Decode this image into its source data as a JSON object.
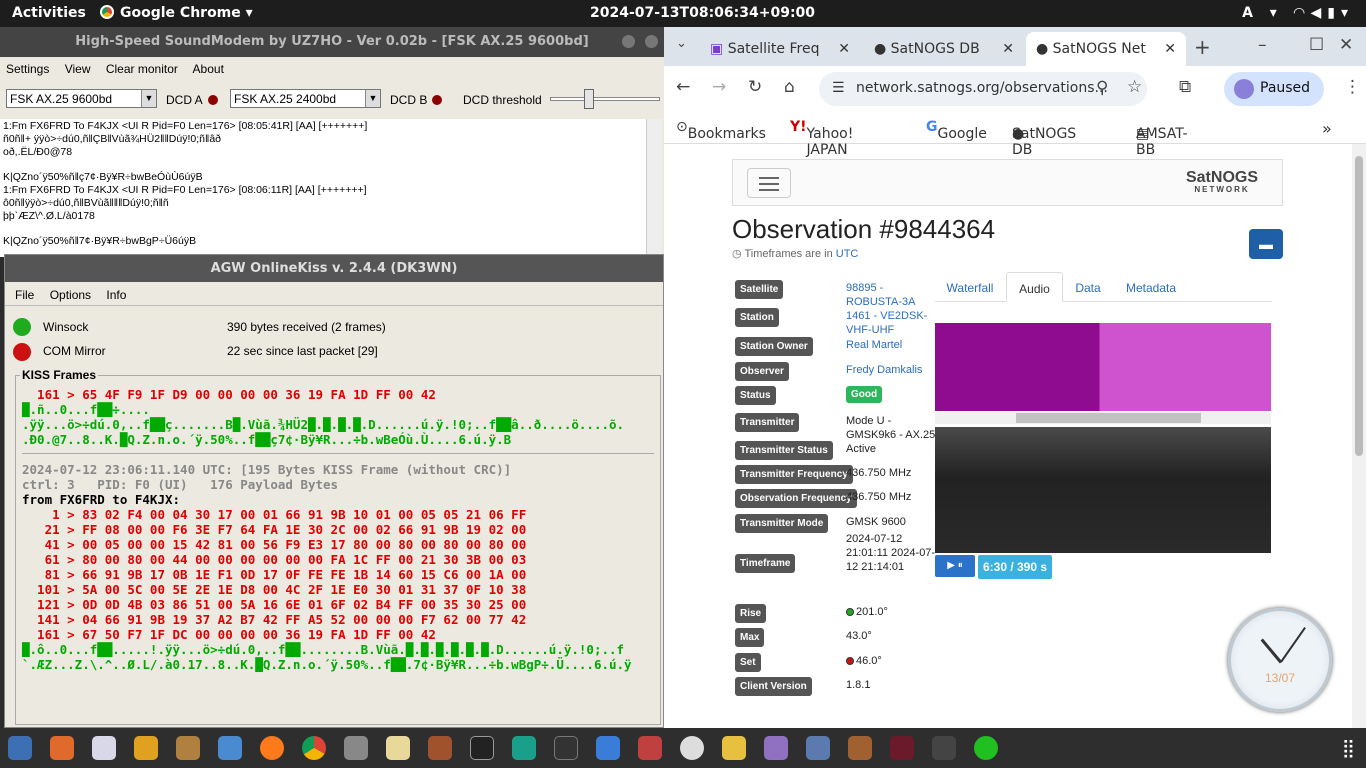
{
  "topbar": {
    "activities": "Activities",
    "app": "Google Chrome ▾",
    "clock": "2024-07-13T08:06:34+09:00",
    "tray": "A ▾"
  },
  "soundmodem": {
    "title": "High-Speed SoundModem by UZ7HO - Ver 0.02b - [FSK AX.25 9600bd]",
    "menu": [
      "Settings",
      "View",
      "Clear monitor",
      "About"
    ],
    "modem_a": "FSK AX.25 9600bd",
    "dcd_a": "DCD A",
    "modem_b": "FSK AX.25 2400bd",
    "dcd_b": "DCD B",
    "threshold": "DCD threshold",
    "monitor": [
      "1:Fm FX6FRD To F4KJX <UI R Pid=F0 Len=176> [08:05:41R] [AA] [+++++++]",
      "ñ0ñ‖+ ÿÿò>÷dú0,ñ‖ÇB‖Vùã¾HÜ2‖‖Dúÿ!0;ñ‖âð",
      "oð,.ËL/Ð0@78",
      "",
      "K|QZno´ÿ50%ñ‖ç7¢·Bÿ¥R÷bwBeÓùÙ6úÿB",
      "1:Fm FX6FRD To F4KJX <UI R Pid=F0 Len=176> [08:06:11R] [AA] [+++++++]",
      "ô0ñ‖ÿÿò>÷dú0,ñ‖BVùã‖‖‖Dúÿ!0;ñ‖ñ",
      "þþ`ÆZ\\^.Ø.L/à0178",
      "",
      "K|QZno´ÿ50%ñ‖7¢·Bÿ¥R÷bwBgP÷Ü6úÿB"
    ]
  },
  "agw": {
    "title": "AGW OnlineKiss v. 2.4.4  (DK3WN)",
    "menu": [
      "File",
      "Options",
      "Info"
    ],
    "status": [
      {
        "name": "Winsock",
        "info": "390 bytes received (2 frames)",
        "color": "#1faa1f"
      },
      {
        "name": "COM Mirror",
        "info": "22 sec since last packet [29]",
        "color": "#cc1111"
      }
    ],
    "frames_label": "KISS Frames",
    "lines_top": [
      {
        "c": "red",
        "t": "  161 > 65 4F F9 1F D9 00 00 00 00 36 19 FA 1D FF 00 42"
      },
      {
        "c": "grn",
        "t": "█.ñ..0...f██÷...."
      },
      {
        "c": "grn",
        "t": ".ÿÿ...ö>÷dú.0,..f██ç.......B█.Vùã.¾HÜ2█.█.█.█.D......ú.ÿ.!0;..f██â..ð....ö....õ."
      },
      {
        "c": "grn",
        "t": ".Ð0.@7..8..K.█Q.Z.n.o.´ÿ.50%..f██ç7¢·Bÿ¥R...÷b.wBeÓù.Ù....6.ú.ÿ.B"
      }
    ],
    "lines_bottom": [
      {
        "c": "gry",
        "t": "2024-07-12 23:06:11.140 UTC: [195 Bytes KISS Frame (without CRC)]"
      },
      {
        "c": "gry",
        "t": "ctrl: 3   PID: F0 (UI)   176 Payload Bytes"
      },
      {
        "c": "blk",
        "t": "from FX6FRD to F4KJX:"
      },
      {
        "c": "red",
        "t": "    1 > 83 02 F4 00 04 30 17 00 01 66 91 9B 10 01 00 05 05 21 06 FF"
      },
      {
        "c": "red",
        "t": "   21 > FF 08 00 00 F6 3E F7 64 FA 1E 30 2C 00 02 66 91 9B 19 02 00"
      },
      {
        "c": "red",
        "t": "   41 > 00 05 00 00 15 42 81 00 56 F9 E3 17 80 00 80 00 80 00 80 00"
      },
      {
        "c": "red",
        "t": "   61 > 80 00 80 00 44 00 00 00 00 00 00 FA 1C FF 00 21 30 3B 00 03"
      },
      {
        "c": "red",
        "t": "   81 > 66 91 9B 17 0B 1E F1 0D 17 0F FE FE 1B 14 60 15 C6 00 1A 00"
      },
      {
        "c": "red",
        "t": "  101 > 5A 00 5C 00 5E 2E 1E D8 00 4C 2F 1E E0 30 01 31 37 0F 10 38"
      },
      {
        "c": "red",
        "t": "  121 > 0D 0D 4B 03 86 51 00 5A 16 6E 01 6F 02 B4 FF 00 35 30 25 00"
      },
      {
        "c": "red",
        "t": "  141 > 04 66 91 9B 19 37 A2 B7 42 FF A5 52 00 00 00 F7 62 00 77 42"
      },
      {
        "c": "red",
        "t": "  161 > 67 50 F7 1F DC 00 00 00 00 36 19 FA 1D FF 00 42"
      },
      {
        "c": "grn",
        "t": "█.ô..0...f██.....!.ÿÿ...ö>÷dú.0,..f██........B.Vùã.█.█.█.█.█.█.D......ú.ÿ.!0;..f"
      },
      {
        "c": "grn",
        "t": "`.ÆZ...Z.\\.^..Ø.L/.à0.17..8..K.█Q.Z.n.o.´ÿ.50%..f██.7¢·Bÿ¥R...÷b.wBgP÷.Ü....6.ú.ÿ"
      }
    ]
  },
  "chrome": {
    "tabs": [
      "Satellite Freq",
      "SatNOGS DB",
      "SatNOGS Net"
    ],
    "url": "network.satnogs.org/observations...",
    "paused": "Paused",
    "bookmarks": [
      "Bookmarks",
      "Yahoo! JAPAN",
      "Google",
      "SatNOGS DB",
      "AMSAT-BB"
    ],
    "page": {
      "brand": "SatNOGS",
      "brand_sub": "NETWORK",
      "title": "Observation #9844364",
      "tz_text": "Timeframes are in ",
      "tz_link": "UTC",
      "rows": [
        {
          "k": "Satellite",
          "v": "98895 - ROBUSTA-3A",
          "link": true
        },
        {
          "k": "Station",
          "v": "1461 - VE2DSK-VHF-UHF",
          "link": true
        },
        {
          "k": "Station Owner",
          "v": "Real Martel",
          "link": true
        },
        {
          "k": "Observer",
          "v": "Fredy Damkalis",
          "link": true
        },
        {
          "k": "Status",
          "v": "Good",
          "badge": true
        },
        {
          "k": "Transmitter",
          "v": "Mode U - GMSK9k6 - AX.25"
        },
        {
          "k": "Transmitter Status",
          "v": "Active"
        },
        {
          "k": "Transmitter Frequency",
          "v": "436.750 MHz"
        },
        {
          "k": "Observation Frequency",
          "v": "436.750 MHz"
        },
        {
          "k": "Transmitter Mode",
          "v": "GMSK 9600"
        },
        {
          "k": "Timeframe",
          "v": "2024-07-12 21:01:11 2024-07-12 21:14:01"
        },
        {
          "k": "Rise",
          "v": "201.0°",
          "dot": "#1faa1f"
        },
        {
          "k": "Max",
          "v": "43.0°"
        },
        {
          "k": "Set",
          "v": "46.0°",
          "dot": "#cc1111"
        },
        {
          "k": "Client Version",
          "v": "1.8.1"
        }
      ],
      "ptabs": [
        "Waterfall",
        "Audio",
        "Data",
        "Metadata"
      ],
      "play": "▶ ⏸",
      "time": "6:30 / 390 s"
    }
  },
  "desktop": {
    "clock_date": "13/07"
  }
}
